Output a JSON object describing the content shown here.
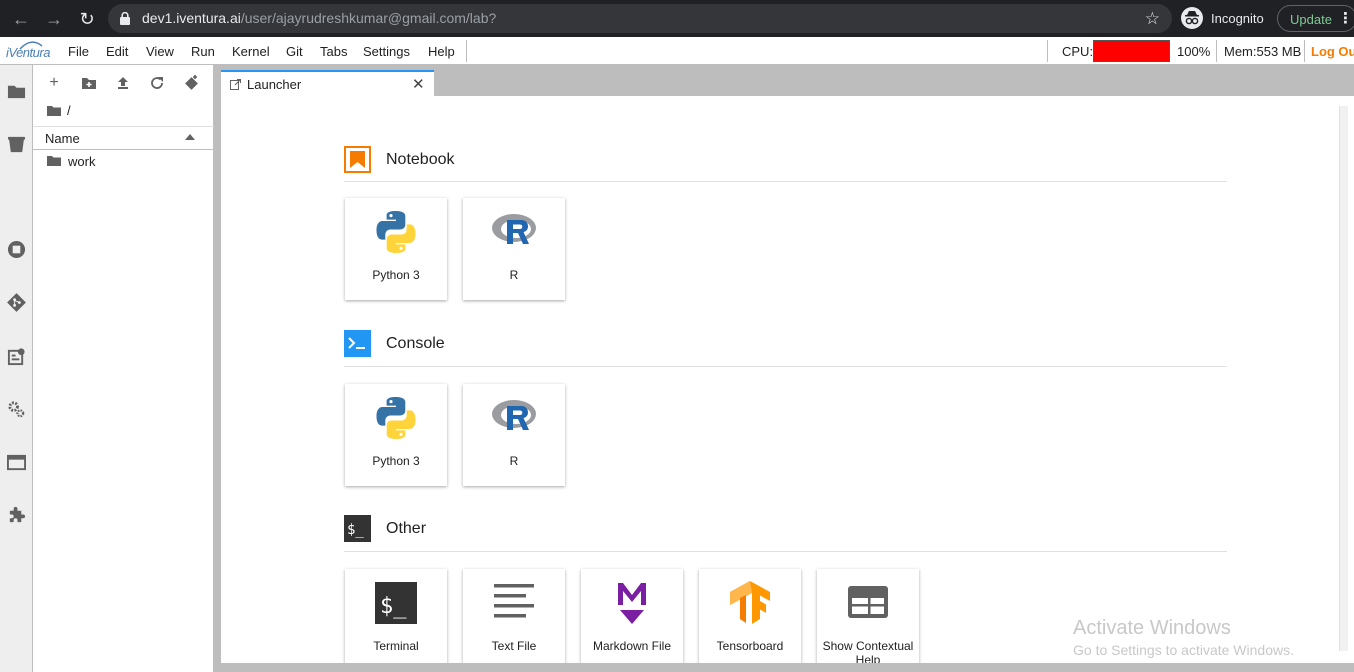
{
  "browser": {
    "url_host": "dev1.iventura.ai",
    "url_path": "/user/ajayrudreshkumar@gmail.com/lab?",
    "incognito_label": "Incognito",
    "update_label": "Update"
  },
  "app": {
    "logo_text": "iVentura",
    "menu": [
      "File",
      "Edit",
      "View",
      "Run",
      "Kernel",
      "Git",
      "Tabs",
      "Settings",
      "Help"
    ],
    "resources": {
      "cpu_label": "CPU:",
      "cpu_percent_text": "100%",
      "cpu_fraction": 1.0,
      "mem_label": "Mem:553 MB"
    },
    "logout_label": "Log Out"
  },
  "filebrowser": {
    "breadcrumb": "/",
    "column_name": "Name",
    "items": [
      "work"
    ]
  },
  "tab": {
    "label": "Launcher"
  },
  "launcher": {
    "notebook": {
      "title": "Notebook",
      "cards": [
        "Python 3",
        "R"
      ]
    },
    "console": {
      "title": "Console",
      "cards": [
        "Python 3",
        "R"
      ]
    },
    "other": {
      "title": "Other",
      "cards": [
        "Terminal",
        "Text File",
        "Markdown File",
        "Tensorboard",
        "Show Contextual Help"
      ]
    }
  },
  "watermark": {
    "line1": "Activate Windows",
    "line2": "Go to Settings to activate Windows."
  },
  "colors": {
    "accent": "#2196f3",
    "notebook_icon": "#f57c00",
    "console_icon": "#2196f3",
    "cpu_fill": "#ff0000",
    "logout": "#f57c00"
  }
}
